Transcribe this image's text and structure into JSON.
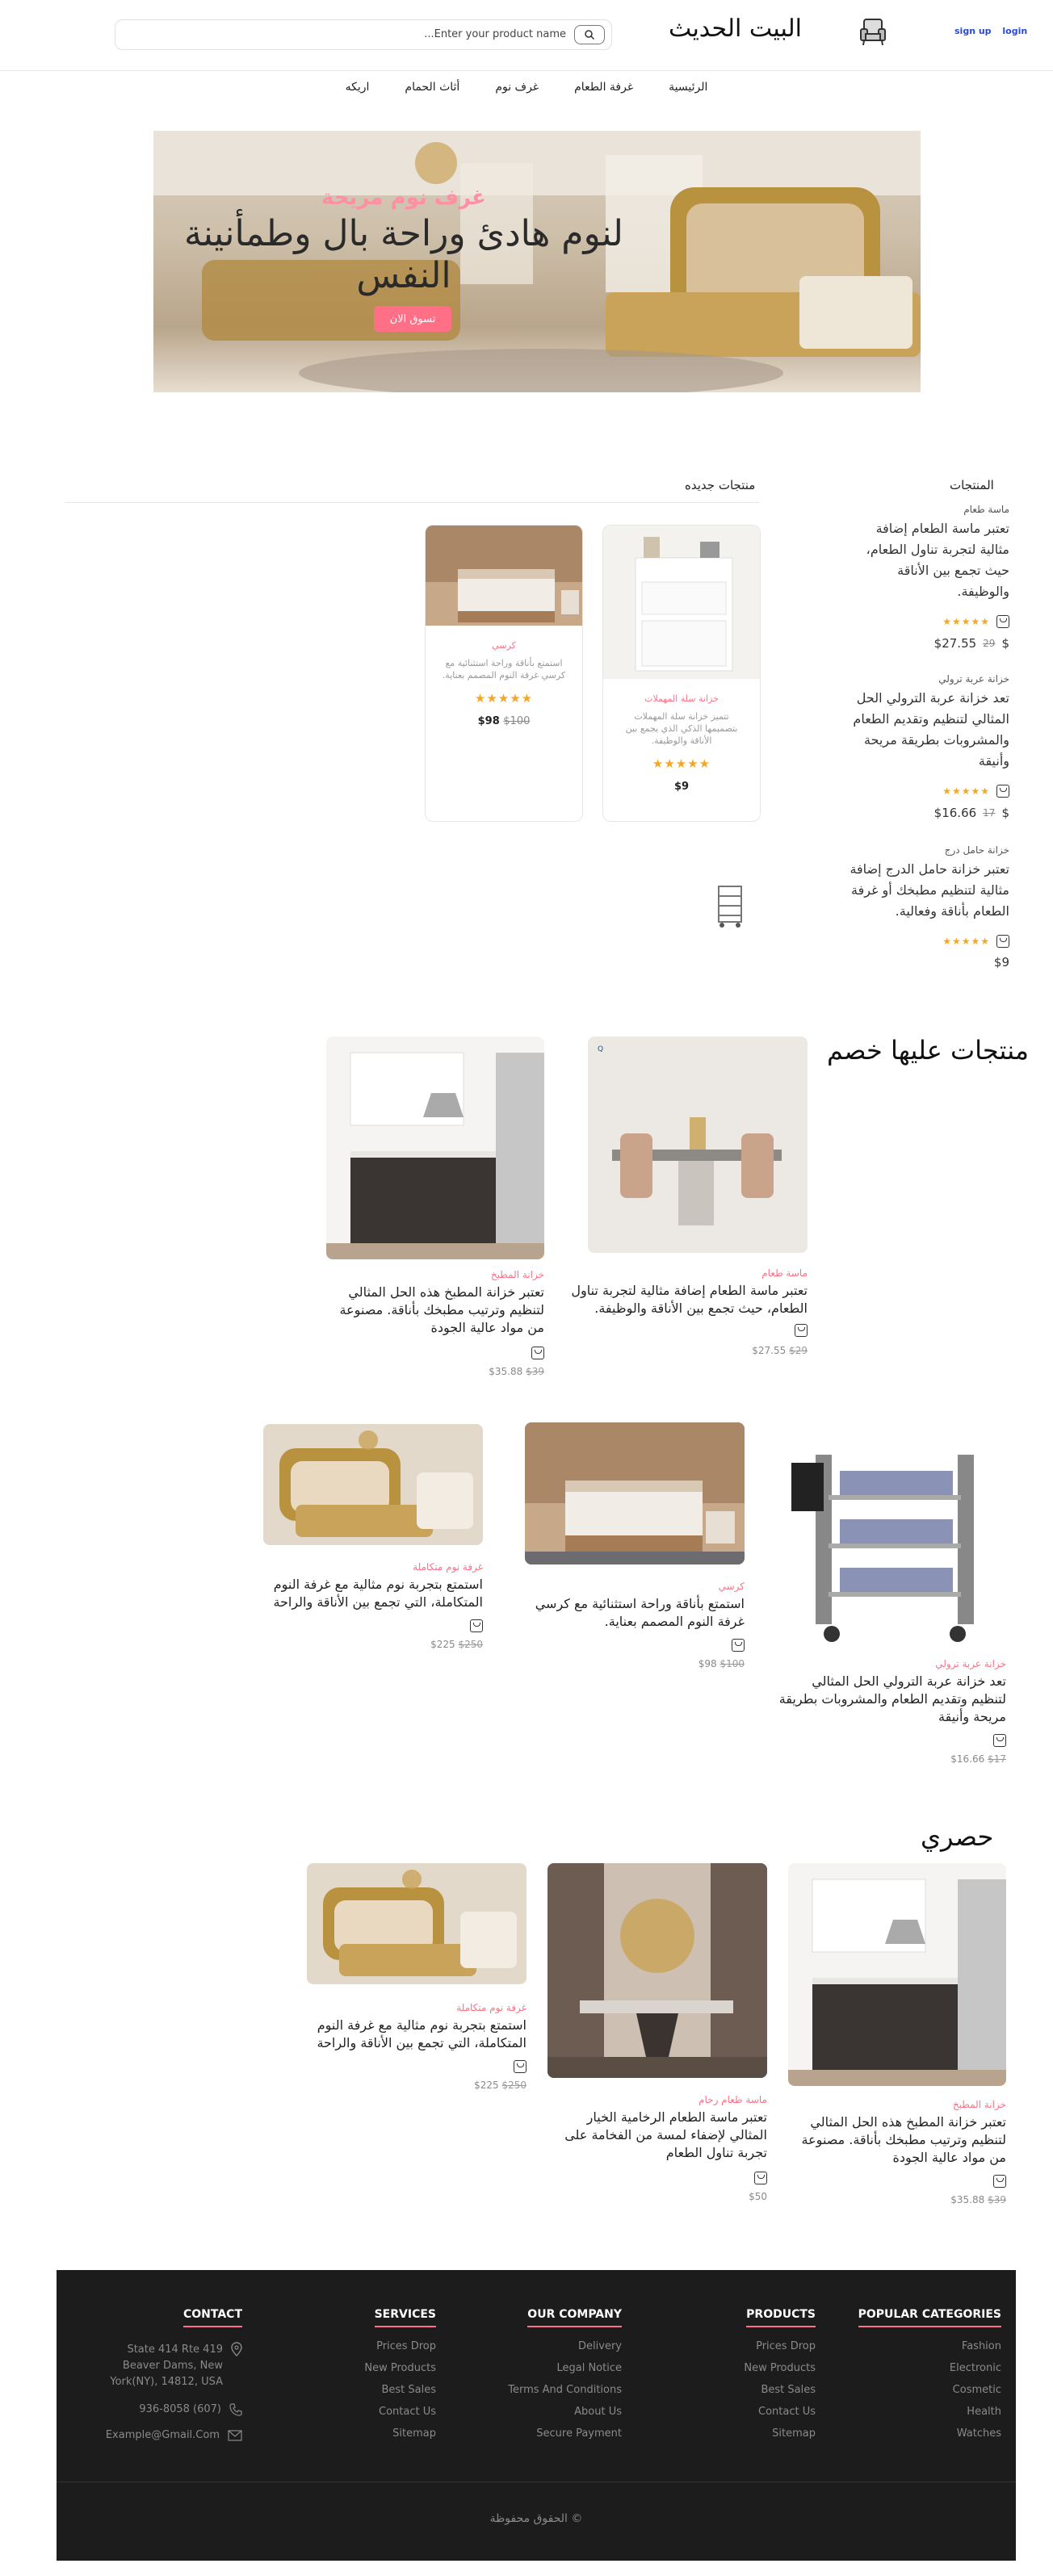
{
  "header": {
    "search_placeholder": "Enter your product name...",
    "brand": "البيت الحديث",
    "signup": "sign up",
    "login": "login"
  },
  "nav": {
    "items": [
      "الرئيسية",
      "غرفة الطعام",
      "غرف نوم",
      "أثاث الحمام",
      "اريكه"
    ]
  },
  "hero": {
    "subtitle": "غرف نوم مريحة",
    "title": "لنوم هادئ وراحة بال وطمأنينة النفس",
    "cta": "تسوق الان"
  },
  "products": {
    "sidebar_title": "المنتجات",
    "new_title": "منتجات جديده",
    "sidebar_items": [
      {
        "category": "ماسة طعام",
        "desc": "تعتبر ماسة الطعام إضافة مثالية لتجربة تناول الطعام، حيث تجمع بين الأناقة والوظيفة.",
        "stars": "★★★★★",
        "price": "$27.55",
        "old_price": "29",
        "currency": "$"
      },
      {
        "category": "خزانة عربة ترولي",
        "desc": "تعد خزانة عربة الترولي الحل المثالي لتنظيم وتقديم الطعام والمشروبات بطريقة مريحة وأنيقة",
        "stars": "★★★★★",
        "price": "$16.66",
        "old_price": "17",
        "currency": "$"
      },
      {
        "category": "خزانة حامل درج",
        "desc": "تعتبر خزانة حامل الدرج إضافة مثالية لتنظيم مطبخك أو غرفة الطعام بأناقة وفعالية.",
        "stars": "★★★★★",
        "price": "$9",
        "old_price": "",
        "currency": ""
      }
    ],
    "cards": [
      {
        "category": "خزانة سلة المهملات",
        "desc": "تتميز خزانة سلة المهملات بتصميمها الذكي الذي يجمع بين الأناقة والوظيفة.",
        "stars": "★★★★★",
        "price": "$9",
        "old_price": ""
      },
      {
        "category": "كرسي",
        "desc": "استمتع بأناقة وراحة استثنائية مع كرسي غرفة النوم المصمم بعناية.",
        "stars": "★★★★★",
        "price": "$98",
        "old_price": "$100"
      }
    ]
  },
  "discount": {
    "title": "منتجات عليها خصم",
    "items": [
      {
        "category": "ماسة طعام",
        "desc": "تعتبر ماسة الطعام إضافة مثالية لتجربة تناول الطعام، حيث تجمع بين الأناقة والوظيفة.",
        "price": "$27.55",
        "old_price": "$29"
      },
      {
        "category": "خزانة المطبخ",
        "desc": "تعتبر خزانة المطبخ هذه الحل المثالي لتنظيم وترتيب مطبخك بأناقة. مصنوعة من مواد عالية الجودة",
        "price": "$35.88",
        "old_price": "$39"
      },
      {
        "category": "خزانة عربة ترولي",
        "desc": "تعد خزانة عربة الترولي الحل المثالي لتنظيم وتقديم الطعام والمشروبات بطريقة مريحة وأنيقة",
        "price": "$16.66",
        "old_price": "$17"
      },
      {
        "category": "كرسي",
        "desc": "استمتع بأناقة وراحة استثنائية مع كرسي غرفة النوم المصمم بعناية.",
        "price": "$98",
        "old_price": "$100"
      },
      {
        "category": "غرفة نوم متكاملة",
        "desc": "استمتع بتجربة نوم مثالية مع غرفة النوم المتكاملة، التي تجمع بين الأناقة والراحة",
        "price": "$225",
        "old_price": "$250"
      }
    ]
  },
  "exclusive": {
    "title": "حصري",
    "items": [
      {
        "category": "خزانة المطبخ",
        "desc": "تعتبر خزانة المطبخ هذه الحل المثالي لتنظيم وترتيب مطبخك بأناقة. مصنوعة من مواد عالية الجودة",
        "price": "$35.88",
        "old_price": "$39"
      },
      {
        "category": "ماسة طعام رخام",
        "desc": "تعتبر ماسة الطعام الرخامية الخيار المثالي لإضفاء لمسة من الفخامة على تجربة تناول الطعام",
        "price": "$50",
        "old_price": ""
      },
      {
        "category": "غرفة نوم متكاملة",
        "desc": "استمتع بتجربة نوم مثالية مع غرفة النوم المتكاملة، التي تجمع بين الأناقة والراحة",
        "price": "$225",
        "old_price": "$250"
      }
    ]
  },
  "footer": {
    "contact": {
      "title": "CONTACT",
      "address_line1": "State 414 Rte 419",
      "address_line2": "Beaver Dams, New",
      "address_line3": "York(NY), 14812, USA",
      "phone": "936-8058 (607)",
      "email": "Example@Gmail.Com"
    },
    "services": {
      "title": "SERVICES",
      "links": [
        "Prices Drop",
        "New Products",
        "Best Sales",
        "Contact Us",
        "Sitemap"
      ]
    },
    "company": {
      "title": "OUR COMPANY",
      "links": [
        "Delivery",
        "Legal Notice",
        "Terms And Conditions",
        "About Us",
        "Secure Payment"
      ]
    },
    "products": {
      "title": "PRODUCTS",
      "links": [
        "Prices Drop",
        "New Products",
        "Best Sales",
        "Contact Us",
        "Sitemap"
      ]
    },
    "categories": {
      "title": "POPULAR CATEGORIES",
      "links": [
        "Fashion",
        "Electronic",
        "Cosmetic",
        "Health",
        "Watches"
      ]
    },
    "copyright": "© الحقوق محفوظة"
  },
  "colors": {
    "accent": "#ff6f86",
    "footer_bg": "#1c1c1c",
    "link_blue": "#2a4bd7",
    "star": "#f6a623"
  }
}
